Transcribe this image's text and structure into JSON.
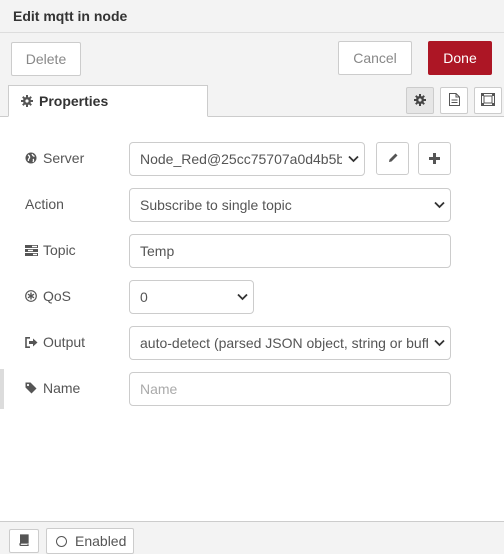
{
  "tray": {
    "title": "Edit mqtt in node"
  },
  "toolbar": {
    "delete_label": "Delete",
    "cancel_label": "Cancel",
    "done_label": "Done"
  },
  "tabs": {
    "properties_label": "Properties",
    "icons": [
      "gear-icon",
      "description-icon",
      "appearance-icon"
    ]
  },
  "form": {
    "server": {
      "label": "Server",
      "value": "Node_Red@25cc75707a0d4b5b",
      "icon": "globe-icon"
    },
    "action": {
      "label": "Action",
      "value": "Subscribe to single topic"
    },
    "topic": {
      "label": "Topic",
      "value": "Temp",
      "icon": "tasks-icon"
    },
    "qos": {
      "label": "QoS",
      "value": "0",
      "icon": "asterisk-icon"
    },
    "output": {
      "label": "Output",
      "value": "auto-detect (parsed JSON object, string or buffer)",
      "icon": "sign-out-icon"
    },
    "name": {
      "label": "Name",
      "value": "",
      "placeholder": "Name",
      "icon": "tag-icon"
    }
  },
  "footer": {
    "enabled_label": "Enabled"
  },
  "colors": {
    "done_bg": "#ad1625",
    "tray_bg": "#f3f3f3",
    "border": "#cccccc"
  }
}
